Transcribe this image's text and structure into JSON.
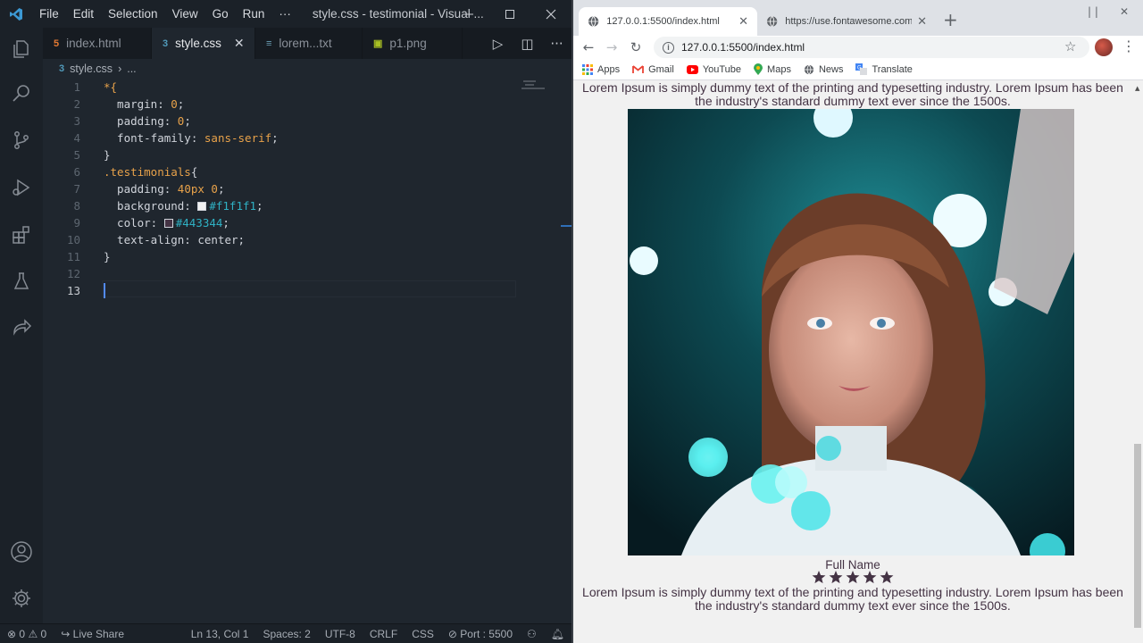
{
  "vscode": {
    "menu": [
      "File",
      "Edit",
      "Selection",
      "View",
      "Go",
      "Run",
      "···"
    ],
    "window_title": "style.css - testimonial - Visual ...",
    "tabs": [
      {
        "label": "index.html",
        "icon": "html-file-icon",
        "icon_color": "#e37933"
      },
      {
        "label": "style.css",
        "icon": "css-file-icon",
        "icon_color": "#519aba",
        "active": true
      },
      {
        "label": "lorem...txt",
        "icon": "text-file-icon",
        "icon_color": "#6a9fb5"
      },
      {
        "label": "p1.png",
        "icon": "image-file-icon",
        "icon_color": "#a8c023"
      }
    ],
    "breadcrumb": {
      "file": "style.css",
      "rest": "..."
    },
    "code": [
      {
        "n": "1"
      },
      {
        "n": "2"
      },
      {
        "n": "3"
      },
      {
        "n": "4"
      },
      {
        "n": "5"
      },
      {
        "n": "6"
      },
      {
        "n": "7"
      },
      {
        "n": "8"
      },
      {
        "n": "9"
      },
      {
        "n": "10"
      },
      {
        "n": "11"
      },
      {
        "n": "12"
      },
      {
        "n": "13"
      }
    ],
    "code_text": {
      "l1_sel": "*{",
      "l2_prop": "  margin: ",
      "l2_val": "0",
      "l2_end": ";",
      "l3_prop": "  padding: ",
      "l3_val": "0",
      "l3_end": ";",
      "l4_prop": "  font-family: ",
      "l4_val": "sans-serif",
      "l4_end": ";",
      "l5": "}",
      "l6_sel": ".testimonials",
      "l6_end": "{",
      "l7_prop": "  padding: ",
      "l7_val": "40px 0",
      "l7_end": ";",
      "l8_prop": "  background: ",
      "l8_val": "#f1f1f1",
      "l8_end": ";",
      "l9_prop": "  color: ",
      "l9_val": "#443344",
      "l9_end": ";",
      "l10_prop": "  text-align: center;",
      "l11": "}"
    },
    "status": {
      "problems": "0",
      "warnings": "0",
      "live_share": "Live Share",
      "position": "Ln 13, Col 1",
      "spaces": "Spaces: 2",
      "encoding": "UTF-8",
      "eol": "CRLF",
      "language": "CSS",
      "port": "Port : 5500"
    }
  },
  "chrome": {
    "tabs": [
      {
        "title": "127.0.0.1:5500/index.html",
        "active": true
      },
      {
        "title": "https://use.fontawesome.com/re"
      }
    ],
    "url": "127.0.0.1:5500/index.html",
    "bookmarks": [
      "Apps",
      "Gmail",
      "YouTube",
      "Maps",
      "News",
      "Translate"
    ]
  },
  "page": {
    "text_top": "Lorem Ipsum is simply dummy text of the printing and typesetting industry. Lorem Ipsum has been the industry's standard dummy text ever since the 1500s.",
    "name": "Full Name",
    "rating": 5,
    "text_bottom": "Lorem Ipsum is simply dummy text of the printing and typesetting industry. Lorem Ipsum has been the industry's standard dummy text ever since the 1500s."
  }
}
